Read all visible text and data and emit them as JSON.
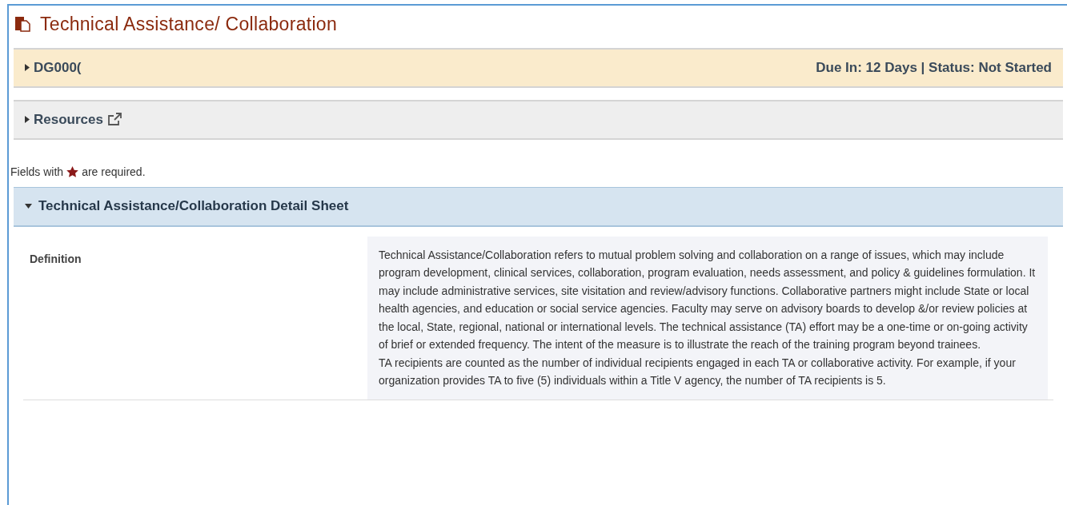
{
  "page_title": "Technical Assistance/ Collaboration",
  "panels": [
    {
      "kind": "status",
      "label": "DG000(",
      "expanded": false,
      "status": "Due In: 12 Days | Status: Not Started"
    },
    {
      "kind": "link",
      "label": "Resources",
      "expanded": false
    }
  ],
  "required_note": {
    "before": "Fields with",
    "after": "are required."
  },
  "section": {
    "title": "Technical Assistance/Collaboration Detail Sheet",
    "expanded": true,
    "fields": [
      {
        "label": "Definition",
        "paragraphs": [
          "Technical Assistance/Collaboration refers to mutual problem solving and collaboration on a range of issues, which may include program development, clinical services, collaboration, program evaluation, needs assessment, and policy & guidelines formulation. It may include administrative services, site visitation and review/advisory functions. Collaborative partners might include State or local health agencies, and education or social service agencies. Faculty may serve on advisory boards to develop &/or review policies at the local, State, regional, national or international levels. The technical assistance (TA) effort may be a one-time or on-going activity of brief or extended frequency. The intent of the measure is to illustrate the reach of the training program beyond trainees.",
          "TA recipients are counted as the number of individual recipients engaged in each TA or collaborative activity. For example, if your organization provides TA to five (5) individuals within a Title V agency, the number of TA recipients is 5."
        ]
      }
    ]
  }
}
